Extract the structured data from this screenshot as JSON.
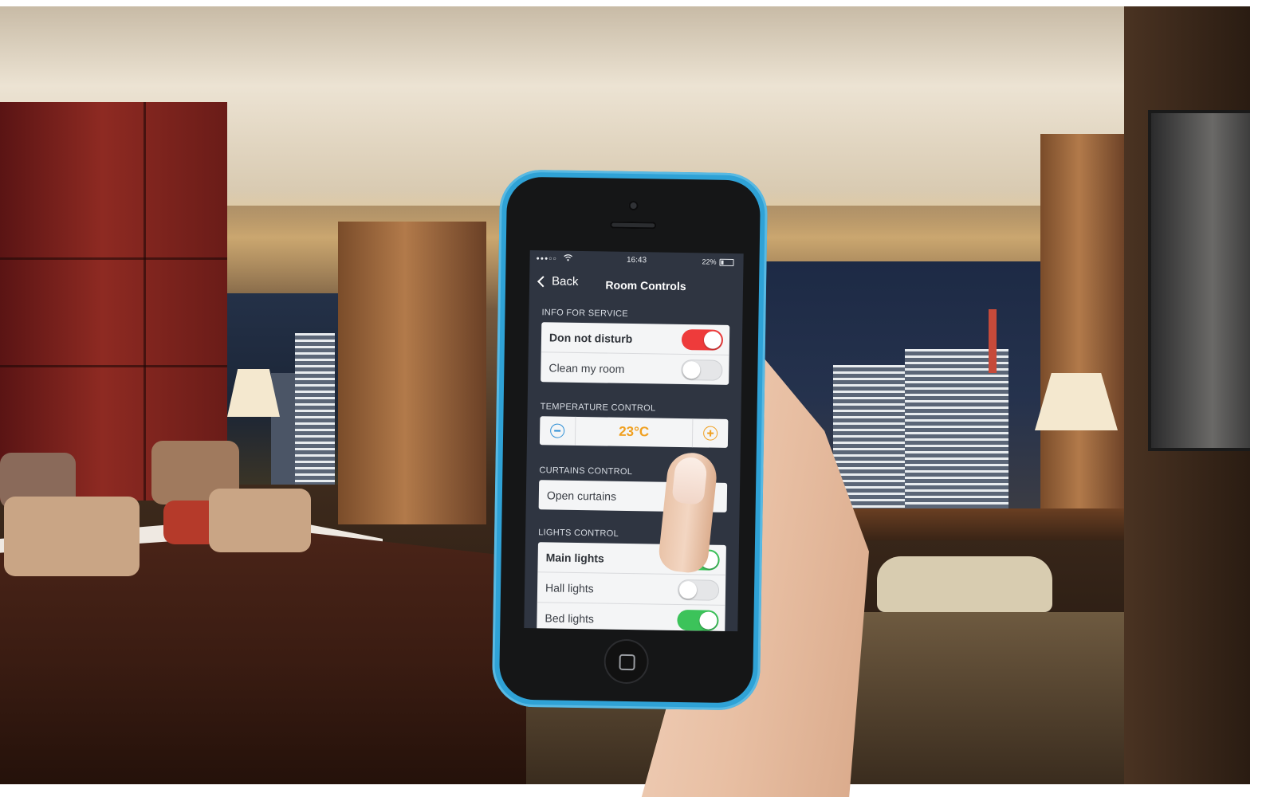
{
  "status_bar": {
    "signal": "●●●○○",
    "time": "16:43",
    "battery": "22%",
    "battery_level": 0.22
  },
  "nav": {
    "back_label": "Back",
    "title": "Room Controls"
  },
  "service": {
    "section": "INFO FOR SERVICE",
    "items": [
      {
        "label": "Don not disturb",
        "state": "on"
      },
      {
        "label": "Clean my room",
        "state": "off"
      }
    ]
  },
  "temperature": {
    "section": "TEMPERATURE CONTROL",
    "value": "23°C"
  },
  "curtains": {
    "section": "CURTAINS CONTROL",
    "items": [
      {
        "label": "Open curtains"
      }
    ]
  },
  "lights": {
    "section": "LIGHTS CONTROL",
    "items": [
      {
        "label": "Main lights",
        "state": "on"
      },
      {
        "label": "Hall lights",
        "state": "off"
      },
      {
        "label": "Bed lights",
        "state": "on"
      }
    ]
  },
  "colors": {
    "phone_case": "#2fa2d6",
    "screen_bg": "#2f3541",
    "toggle_red": "#ee3b3b",
    "toggle_green": "#3cc35a",
    "temp_orange": "#f0a020",
    "minus_blue": "#2d8fd6"
  },
  "icons": [
    "wifi-icon",
    "battery-icon",
    "chevron-left-icon",
    "minus-circle-icon",
    "plus-circle-icon",
    "home-button-icon"
  ]
}
